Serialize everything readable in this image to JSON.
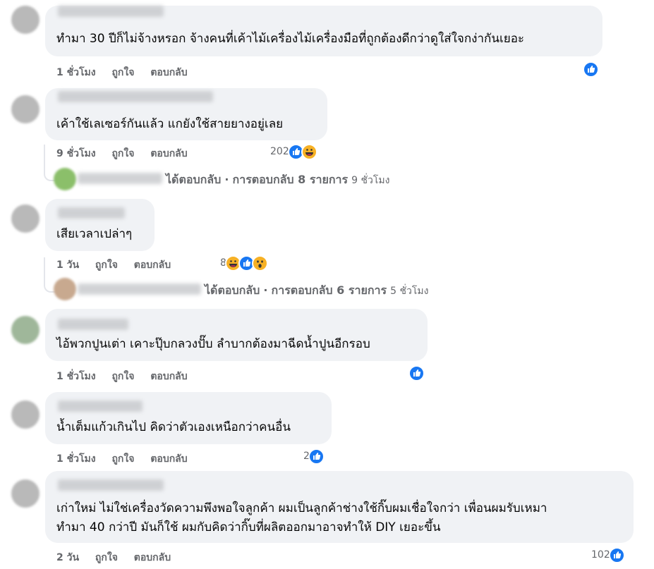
{
  "comments": [
    {
      "text_lines": [
        "ทำมา 30 ปีก็ไม่จ้างหรอก จ้างคนที่เค้าไม้เครื่องไม้เครื่องมือที่ถูกต้องดีกว่าดูใส่ใจกง่ากันเยอะ"
      ],
      "time": "1 ชั่วโมง",
      "like": "ถูกใจ",
      "reply": "ตอบกลับ",
      "reaction_count": "",
      "reactions": [
        "like"
      ]
    },
    {
      "text_lines": [
        "เค้าใช้เลเซอร์กันแล้ว แกยังใช้สายยางอยู่เลย"
      ],
      "time": "9 ชั่วโมง",
      "like": "ถูกใจ",
      "reply": "ตอบกลับ",
      "reaction_count": "202",
      "reactions": [
        "like",
        "haha"
      ],
      "replies_summary": {
        "prefix": "ได้ตอบกลับ",
        "separator": "·",
        "count_text": "การตอบกลับ 8 รายการ",
        "time": "9 ชั่วโมง"
      }
    },
    {
      "text_lines": [
        "เสียเวลาเปล่าๆ"
      ],
      "time": "1 วัน",
      "like": "ถูกใจ",
      "reply": "ตอบกลับ",
      "reaction_count": "8",
      "reactions": [
        "haha",
        "like",
        "wow"
      ],
      "replies_summary": {
        "prefix": "ได้ตอบกลับ",
        "separator": "·",
        "count_text": "การตอบกลับ 6 รายการ",
        "time": "5 ชั่วโมง"
      }
    },
    {
      "text_lines": [
        "ไอ้พวกปูนเต่า เคาะปุ๊บกลวงปั๊บ ลำบากต้องมาฉีดน้ำปูนอีกรอบ"
      ],
      "time": "1 ชั่วโมง",
      "like": "ถูกใจ",
      "reply": "ตอบกลับ",
      "reaction_count": "",
      "reactions": [
        "like"
      ]
    },
    {
      "text_lines": [
        "น้ำเต็มแก้วเกินไป คิดว่าตัวเองเหนือกว่าคนอื่น"
      ],
      "time": "1 ชั่วโมง",
      "like": "ถูกใจ",
      "reply": "ตอบกลับ",
      "reaction_count": "2",
      "reactions": [
        "like"
      ]
    },
    {
      "text_lines": [
        "เก่าใหม่ ไม่ใช่เครื่องวัดความพึงพอใจลูกค้า ผมเป็นลูกค้าช่างใช้กิ๊บผมเชื่อใจกว่า เพื่อนผมรับเหมา",
        "ทำมา 40 กว่าปี มันก็ใช้ ผมกับคิดว่ากิ๊บที่ผลิตออกมาอาจทำให้ DIY เยอะขึ้น"
      ],
      "time": "2 วัน",
      "like": "ถูกใจ",
      "reply": "ตอบกลับ",
      "reaction_count": "102",
      "reactions": [
        "like"
      ]
    }
  ],
  "colors": {
    "bubble": "#f0f2f5",
    "meta_text": "#65676b",
    "like_blue": "#1877f2",
    "emoji_yellow": "#f7b125"
  }
}
